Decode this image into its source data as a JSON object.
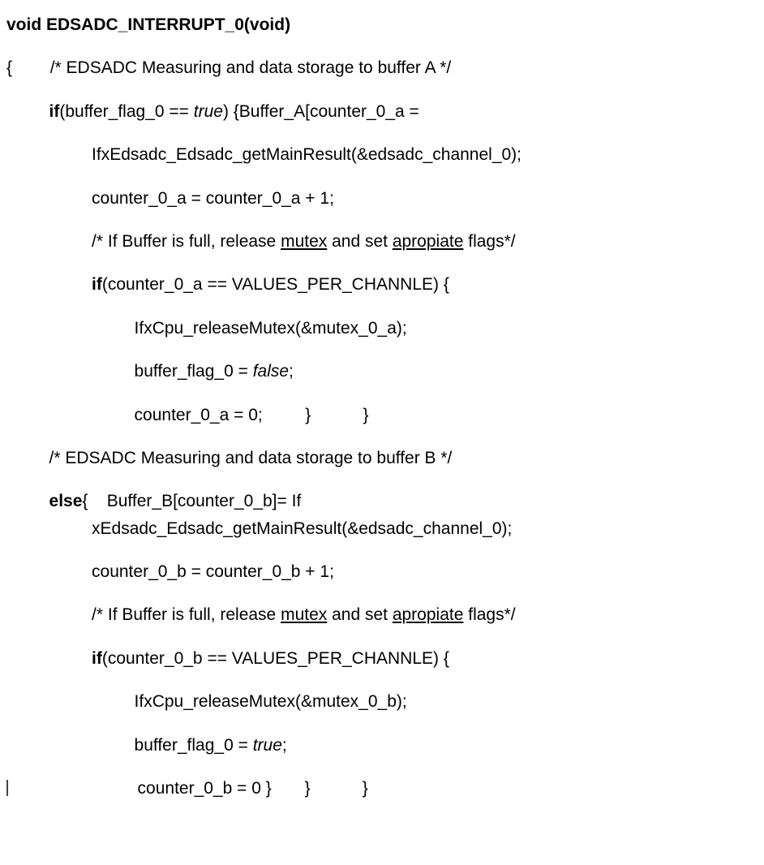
{
  "code": {
    "l1_a": "void",
    "l1_b": " EDSADC_INTERRUPT_0(",
    "l1_c": "void",
    "l1_d": ")",
    "l2_a": "{        /* EDSADC Measuring and data storage to buffer A */",
    "l3_a": "         if",
    "l3_b": "(buffer_flag_0 == ",
    "l3_c": "true",
    "l3_d": ") {Buffer_A[counter_0_a =",
    "l4_a": "                  IfxEdsadc_Edsadc_getMainResult(&edsadc_channel_0);",
    "l5_a": "                  counter_0_a = counter_0_a + 1;",
    "l6_a": "                  /* If Buffer is full, release ",
    "l6_b": "mutex",
    "l6_c": " and set ",
    "l6_d": "apropiate",
    "l6_e": " flags*/",
    "l7_a": "                  if",
    "l7_b": "(counter_0_a == VALUES_PER_CHANNLE) {",
    "l8_a": "                           IfxCpu_releaseMutex(&mutex_0_a);",
    "l9_a": "                           buffer_flag_0 = ",
    "l9_b": "false",
    "l9_c": ";",
    "l10_a": "                           counter_0_a = 0;         }           }",
    "l11_a": "         /* EDSADC Measuring and data storage to buffer B */",
    "l12_a": "         else",
    "l12_b": "{    Buffer_B[counter_0_b]= If",
    "l12_c": "                  xEdsadc_Edsadc_getMainResult(&edsadc_channel_0);",
    "l13_a": "                  counter_0_b = counter_0_b + 1;",
    "l14_a": "                  /* If Buffer is full, release ",
    "l14_b": "mutex",
    "l14_c": " and set ",
    "l14_d": "apropiate",
    "l14_e": " flags*/",
    "l15_a": "                  if",
    "l15_b": "(counter_0_b == VALUES_PER_CHANNLE) {",
    "l16_a": "                           IfxCpu_releaseMutex(&mutex_0_b);",
    "l17_a": "                           buffer_flag_0 = ",
    "l17_b": "true",
    "l17_c": ";",
    "l18_a": "                           counter_0_b = 0 }       }           }"
  }
}
